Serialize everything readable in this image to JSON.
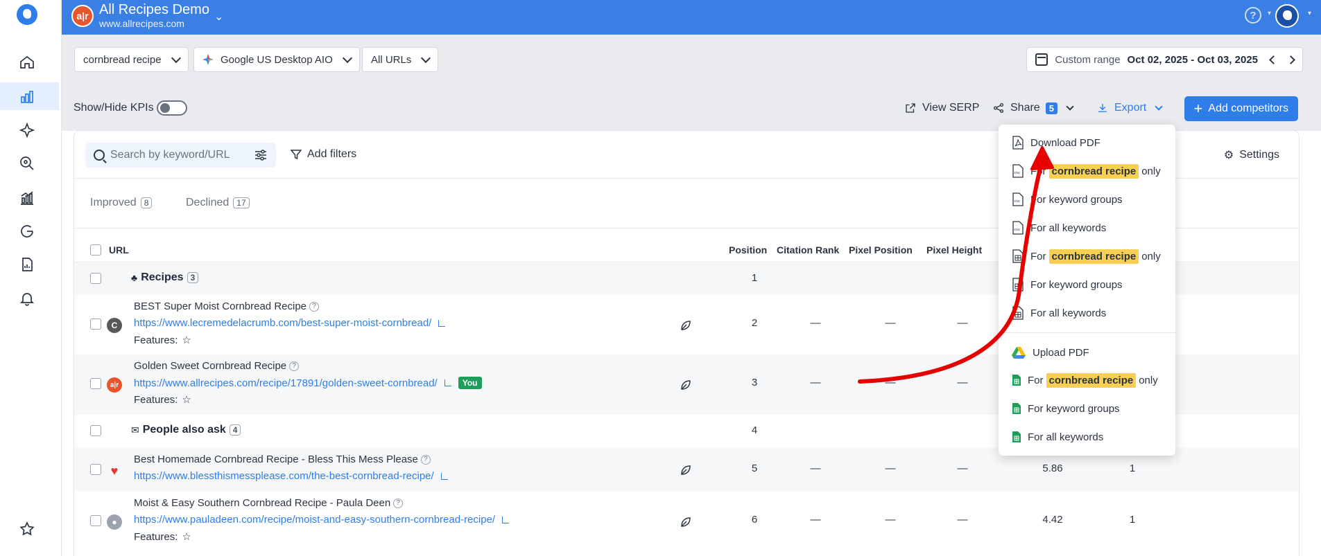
{
  "app": {
    "name": "All Recipes Demo",
    "domain": "www.allrecipes.com",
    "logo_text": "a|r"
  },
  "filters": {
    "keyword": "cornbread recipe",
    "engine": "Google US Desktop AIO",
    "urls": "All URLs",
    "range_label": "Custom range",
    "range_value": "Oct 02, 2025 - Oct 03, 2025"
  },
  "toolbar": {
    "kpi_label": "Show/Hide KPIs",
    "view_serp": "View SERP",
    "share": "Share",
    "share_count": "5",
    "export": "Export",
    "add_competitors": "Add competitors"
  },
  "card": {
    "search_placeholder": "Search by keyword/URL",
    "add_filters": "Add filters",
    "settings": "Settings",
    "tabs": [
      {
        "label": "Improved",
        "count": "8"
      },
      {
        "label": "Declined",
        "count": "17"
      }
    ]
  },
  "table": {
    "headers": {
      "url": "URL",
      "position": "Position",
      "citation_rank": "Citation Rank",
      "pixel_position": "Pixel Position",
      "pixel_height": "Pixel Height"
    },
    "dash": "—",
    "features_label": "Features:",
    "you_badge": "You",
    "groups": [
      {
        "label": "Recipes",
        "count": "3",
        "position": "1"
      },
      {
        "label": "People also ask",
        "count": "4",
        "position": "4"
      }
    ],
    "rows": [
      {
        "title": "BEST Super Moist Cornbread Recipe",
        "url": "https://www.lecremedelacrumb.com/best-super-moist-cornbread/",
        "position": "2",
        "fav": "C"
      },
      {
        "title": "Golden Sweet Cornbread Recipe",
        "url": "https://www.allrecipes.com/recipe/17891/golden-sweet-cornbread/",
        "position": "3",
        "fav": "a|r"
      },
      {
        "title": "Best Homemade Cornbread Recipe - Bless This Mess Please",
        "url": "https://www.blessthismessplease.com/the-best-cornbread-recipe/",
        "position": "5",
        "extra1": "5.86",
        "extra2": "1"
      },
      {
        "title": "Moist & Easy Southern Cornbread Recipe - Paula Deen",
        "url": "https://www.pauladeen.com/recipe/moist-and-easy-southern-cornbread-recipe/",
        "position": "6",
        "extra1": "4.42",
        "extra2": "1"
      }
    ]
  },
  "export_menu": {
    "download_pdf": "Download PDF",
    "for": "For",
    "only": "only",
    "keyword": "cornbread recipe",
    "keyword_groups": "For keyword groups",
    "all_keywords": "For all keywords",
    "upload_pdf": "Upload PDF"
  },
  "colors": {
    "accent": "#3a7fe3",
    "highlight": "#f7cf52",
    "annotation": "#e60000"
  }
}
